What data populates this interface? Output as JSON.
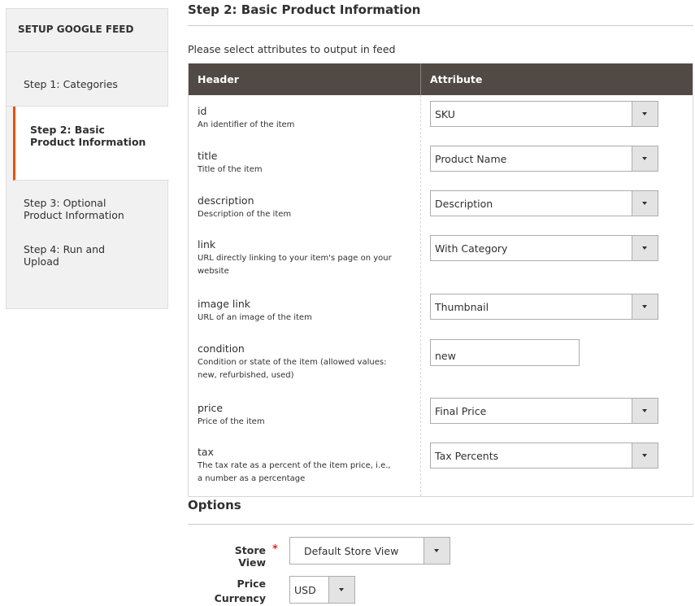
{
  "sidebar": {
    "title": "SETUP GOOGLE FEED",
    "steps": [
      {
        "label_line1": "Step 1: Categories",
        "label_line2": ""
      },
      {
        "label_line1": "Step 2: Basic",
        "label_line2": "Product Information"
      },
      {
        "label_line1": "Step 3: Optional",
        "label_line2": "Product Information"
      },
      {
        "label_line1": "Step 4: Run and",
        "label_line2": "Upload"
      }
    ],
    "active_color": "#eb5202"
  },
  "main": {
    "step_title": "Step 2: Basic Product Information",
    "subtitle": "Please select attributes to output in feed",
    "table": {
      "header_col": "Header",
      "attribute_col": "Attribute",
      "header_bg": "#514943",
      "rows": [
        {
          "name": "id",
          "desc1": "An identifier of the item",
          "desc2": "",
          "value": "SKU",
          "control": "select"
        },
        {
          "name": "title",
          "desc1": "Title of the item",
          "desc2": "",
          "value": "Product Name",
          "control": "select"
        },
        {
          "name": "description",
          "desc1": "Description of the item",
          "desc2": "",
          "value": "Description",
          "control": "select"
        },
        {
          "name": "link",
          "desc1": "URL directly linking to your item's page on your",
          "desc2": "website",
          "value": "With Category",
          "control": "select"
        },
        {
          "name": "image link",
          "desc1": "URL of an image of the item",
          "desc2": "",
          "value": "Thumbnail",
          "control": "select"
        },
        {
          "name": "condition",
          "desc1": "Condition or state of the item (allowed values:",
          "desc2": "new, refurbished, used)",
          "value": "new",
          "control": "text"
        },
        {
          "name": "price",
          "desc1": "Price of the item",
          "desc2": "",
          "value": "Final Price",
          "control": "select"
        },
        {
          "name": "tax",
          "desc1": "The tax rate as a percent of the item price, i.e.,",
          "desc2": "a number as a percentage",
          "value": "Tax Percents",
          "control": "select"
        }
      ]
    }
  },
  "options": {
    "title": "Options",
    "store_view": {
      "label": "Store View",
      "required_mark": "*",
      "value": "Default Store View"
    },
    "price_currency": {
      "label_line1": "Price",
      "label_line2": "Currency",
      "value": "USD"
    }
  }
}
